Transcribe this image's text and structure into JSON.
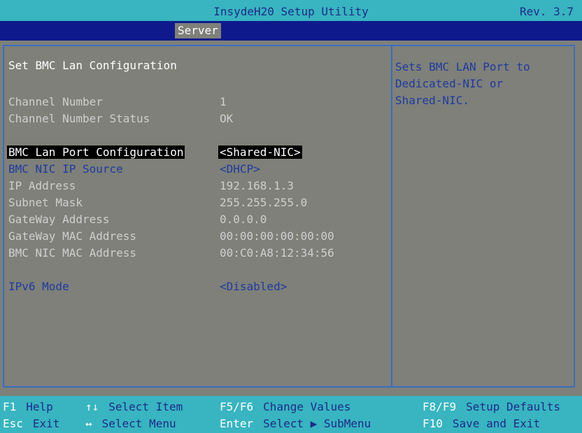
{
  "title_bar": {
    "app_title": "InsydeH20 Setup Utility",
    "revision": "Rev. 3.7"
  },
  "menu": {
    "active_tab": "Server"
  },
  "page": {
    "section_title": "Set BMC Lan Configuration",
    "rows": [
      {
        "label": "Channel Number",
        "value": "1"
      },
      {
        "label": "Channel Number Status",
        "value": "OK"
      },
      {
        "label": "BMC Lan Port Configuration",
        "value": "<Shared-NIC>"
      },
      {
        "label": "BMC NIC IP Source",
        "value": "<DHCP>"
      },
      {
        "label": "IP Address",
        "value": "192.168.1.3"
      },
      {
        "label": "Subnet Mask",
        "value": "255.255.255.0"
      },
      {
        "label": "GateWay Address",
        "value": "0.0.0.0"
      },
      {
        "label": "GateWay MAC Address",
        "value": "00:00:00:00:00:00"
      },
      {
        "label": "BMC NIC MAC Address",
        "value": "00:C0:A8:12:34:56"
      },
      {
        "label": "IPv6 Mode",
        "value": "<Disabled>"
      }
    ]
  },
  "help": {
    "lines": [
      "Sets BMC LAN Port to",
      "Dedicated-NIC or",
      "Shared-NIC."
    ]
  },
  "footer": {
    "items": [
      {
        "key": "F1",
        "desc": "Help"
      },
      {
        "key": "↑↓",
        "desc": "Select Item"
      },
      {
        "key": "F5/F6",
        "desc": "Change Values"
      },
      {
        "key": "F8/F9",
        "desc": "Setup Defaults"
      },
      {
        "key": "Esc",
        "desc": "Exit"
      },
      {
        "key": "↔",
        "desc": "Select Menu"
      },
      {
        "key": "Enter",
        "desc": "Select ▶ SubMenu"
      },
      {
        "key": "F10",
        "desc": "Save and Exit"
      }
    ]
  },
  "colors": {
    "background": "#7e8079",
    "title_bar": "#38b5c0",
    "menu_bar": "#0e1a8c",
    "highlight_blue": "#1f3aa0",
    "frame": "#3c6cc0"
  }
}
